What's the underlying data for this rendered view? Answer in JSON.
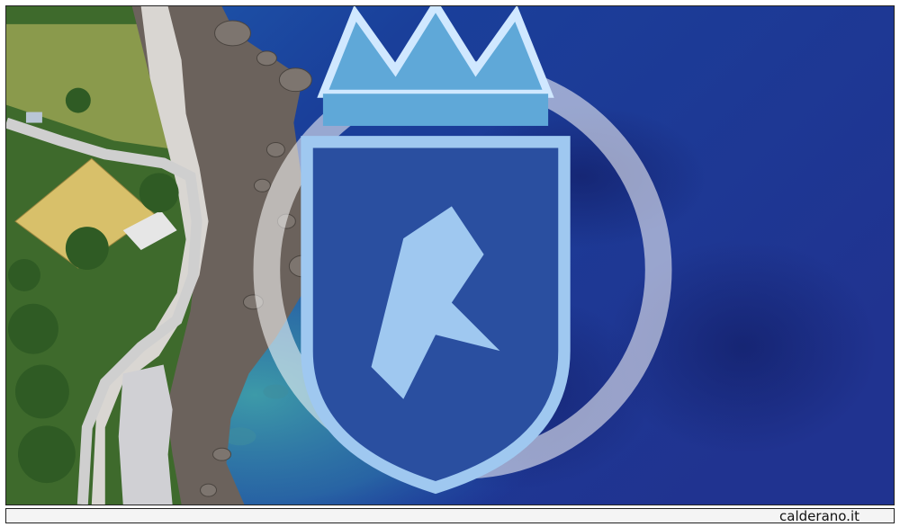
{
  "photo": {
    "subject": "aerial-coastline",
    "colors": {
      "deep_sea": "#1a2f8f",
      "mid_sea": "#1f4fae",
      "shallow_sea": "#2f8fa6",
      "rocks": "#6b625c",
      "road": "#c9c9c9",
      "vegetation": "#3e6a2c",
      "grass": "#8a9a4c",
      "roof": "#d8c06a"
    }
  },
  "watermark": {
    "site": "calderano.it",
    "crest_icon": "town-crest-icon"
  }
}
